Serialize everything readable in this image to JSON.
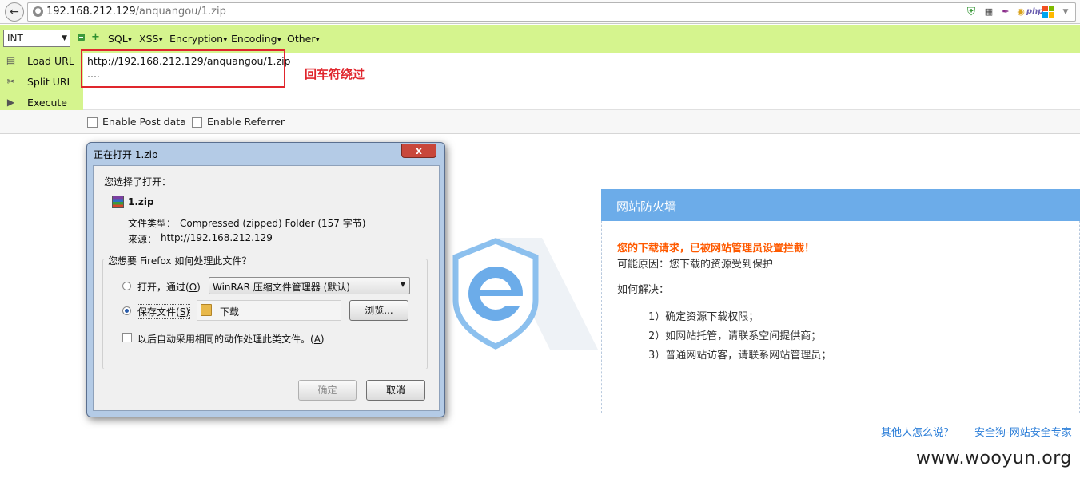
{
  "browser": {
    "url_host": "192.168.212.129",
    "url_path": "/anquangou/1.zip",
    "toolbar_icons": [
      "shield-check-icon",
      "qr-code-icon",
      "feather-icon",
      "lock-icon",
      "php-icon",
      "windows-icon",
      "dropdown-icon"
    ],
    "php_label": "php"
  },
  "hackbar": {
    "type_select": "INT",
    "menus": [
      "SQL",
      "XSS",
      "Encryption",
      "Encoding",
      "Other"
    ],
    "load_url": "Load URL",
    "split_url": "Split URL",
    "execute": "Execute",
    "textarea_line1": "http://192.168.212.129/anquangou/1.zip",
    "textarea_line2": "....",
    "annotation": "回车符绕过",
    "enable_post": "Enable Post data",
    "enable_referrer": "Enable Referrer"
  },
  "dialog": {
    "title": "正在打开 1.zip",
    "close": "x",
    "intro": "您选择了打开：",
    "file_name": "1.zip",
    "file_type_label": "文件类型：",
    "file_type_value": "Compressed (zipped) Folder (157 字节)",
    "source_label": "来源：",
    "source_value": "http://192.168.212.129",
    "question": "您想要 Firefox 如何处理此文件？",
    "open_with_label": "打开，通过(",
    "open_with_key": "O",
    "open_with_app": "WinRAR 压缩文件管理器 (默认)",
    "save_label": "保存文件(",
    "save_key": "S",
    "folder": "下载",
    "browse": "浏览...",
    "auto_label": "以后自动采用相同的动作处理此类文件。(",
    "auto_key": "A",
    "ok": "确定",
    "cancel": "取消",
    "open_selected": false,
    "save_selected": true
  },
  "firewall": {
    "title": "网站防火墙",
    "alert": "您的下载请求，已被网站管理员设置拦截！",
    "reason": "可能原因：您下载的资源受到保护",
    "how": "如何解决：",
    "steps": [
      "1）确定资源下载权限；",
      "2）如网站托管，请联系空间提供商；",
      "3）普通网站访客，请联系网站管理员；"
    ],
    "link_others": "其他人怎么说？",
    "link_brand": "安全狗-网站安全专家"
  },
  "watermark": "www.wooyun.org",
  "colors": {
    "hackbar_green": "#d5f48e",
    "annotation_red": "#e0262d",
    "firewall_blue": "#6cace9",
    "alert_orange": "#ff5a00"
  }
}
